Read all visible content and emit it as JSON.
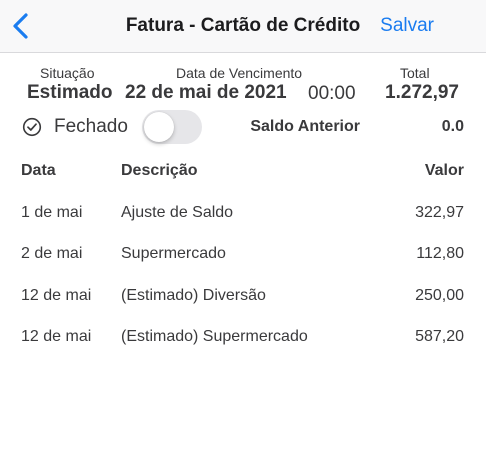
{
  "nav": {
    "title": "Fatura - Cartão de Crédito",
    "save_label": "Salvar",
    "accent_color": "#1a7cf0"
  },
  "summary": {
    "status_label": "Situação",
    "status_value": "Estimado",
    "due_label": "Data de Vencimento",
    "due_date": "22 de mai de 2021",
    "due_time": "00:00",
    "total_label": "Total",
    "total_value": "1.272,97"
  },
  "closed": {
    "icon": "check-circle-icon",
    "label": "Fechado",
    "toggle_on": false
  },
  "previous_balance": {
    "label": "Saldo Anterior",
    "value": "0.0"
  },
  "table": {
    "headers": {
      "date": "Data",
      "description": "Descrição",
      "value": "Valor"
    },
    "rows": [
      {
        "date": "1 de mai",
        "description": "Ajuste de Saldo",
        "value": "322,97"
      },
      {
        "date": "2 de mai",
        "description": "Supermercado",
        "value": "112,80"
      },
      {
        "date": "12 de mai",
        "description": "(Estimado) Diversão",
        "value": "250,00"
      },
      {
        "date": "12 de mai",
        "description": "(Estimado) Supermercado",
        "value": "587,20"
      }
    ]
  }
}
